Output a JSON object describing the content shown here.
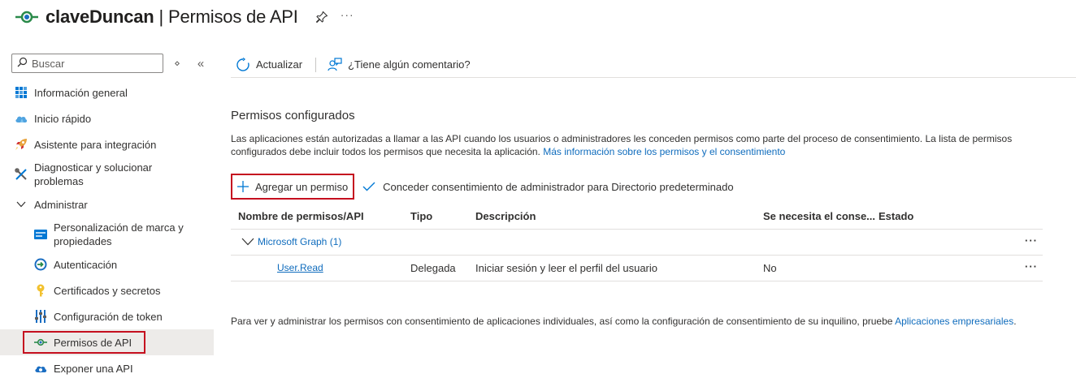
{
  "header": {
    "app_name": "claveDuncan",
    "separator": "|",
    "page_name": "Permisos de API",
    "more": "···"
  },
  "sidebar": {
    "search_placeholder": "Buscar",
    "filter_glyph": "⋄",
    "collapse_glyph": "«",
    "items": [
      {
        "label": "Información general",
        "icon": "grid-icon"
      },
      {
        "label": "Inicio rápido",
        "icon": "cloud-icon"
      },
      {
        "label": "Asistente para integración",
        "icon": "rocket-icon"
      },
      {
        "label": "Diagnosticar y solucionar problemas",
        "icon": "wrench-icon"
      },
      {
        "label": "Administrar",
        "icon": "chevron-down-icon"
      },
      {
        "label": "Personalización de marca y propiedades",
        "icon": "branding-icon"
      },
      {
        "label": "Autenticación",
        "icon": "auth-icon"
      },
      {
        "label": "Certificados y secretos",
        "icon": "key-icon"
      },
      {
        "label": "Configuración de token",
        "icon": "token-config-icon"
      },
      {
        "label": "Permisos de API",
        "icon": "api-permissions-icon",
        "selected": true
      },
      {
        "label": "Exponer una API",
        "icon": "cloud-api-icon"
      }
    ]
  },
  "toolbar": {
    "refresh_label": "Actualizar",
    "feedback_label": "¿Tiene algún comentario?"
  },
  "main": {
    "section_title": "Permisos configurados",
    "description": "Las aplicaciones están autorizadas a llamar a las API cuando los usuarios o administradores les conceden permisos como parte del proceso de consentimiento. La lista de permisos configurados debe incluir todos los permisos que necesita la aplicación.",
    "description_link": "Más información sobre los permisos y el consentimiento",
    "add_permission_label": "Agregar un permiso",
    "grant_consent_label": "Conceder consentimiento de administrador para Directorio predeterminado",
    "table": {
      "headers": [
        "Nombre de permisos/API",
        "Tipo",
        "Descripción",
        "Se necesita el conse...",
        "Estado"
      ],
      "group": {
        "name": "Microsoft Graph (1)",
        "more": "···"
      },
      "rows": [
        {
          "name": "User.Read",
          "type": "Delegada",
          "description": "Iniciar sesión y leer el perfil del usuario",
          "admin_consent": "No",
          "status": "",
          "more": "···"
        }
      ]
    },
    "footer_text": "Para ver y administrar los permisos con consentimiento de aplicaciones individuales, así como la configuración de consentimiento de su inquilino, pruebe",
    "footer_link": "Aplicaciones empresariales",
    "footer_end": "."
  },
  "colors": {
    "accent": "#0f6cbd",
    "highlight_border": "#c50f1f",
    "selected_bg": "#edebe9"
  }
}
